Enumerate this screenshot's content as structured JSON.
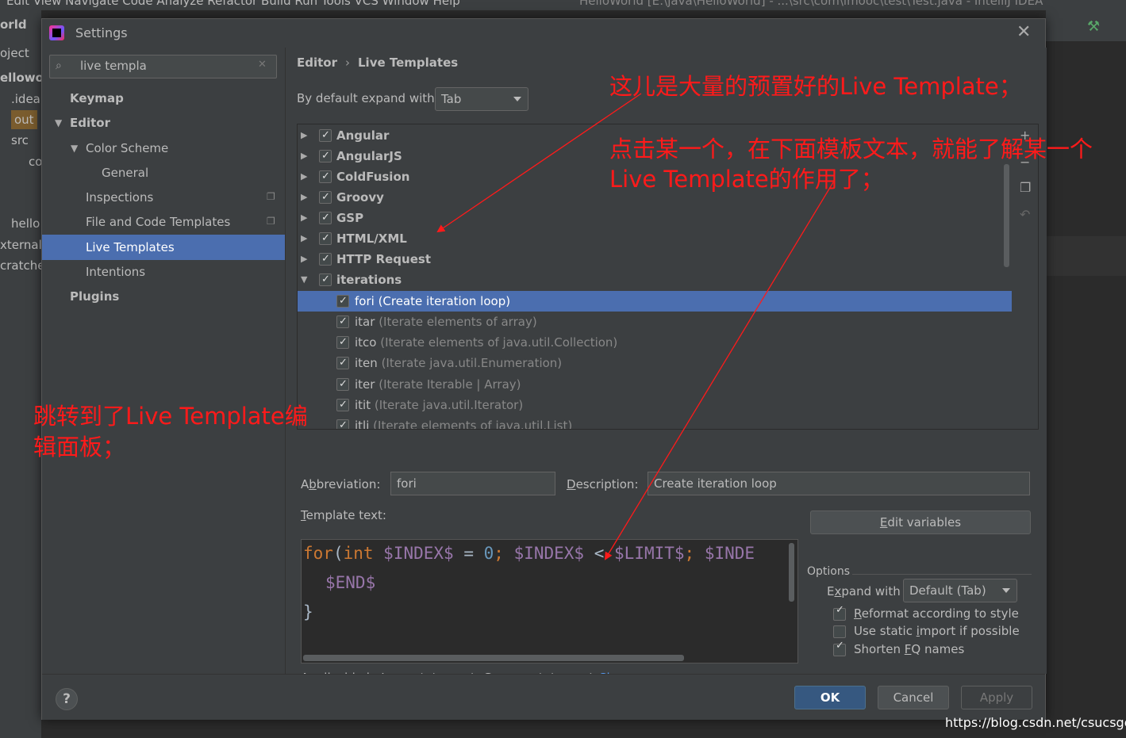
{
  "ide": {
    "menu_fragment": "Edit  View  Navigate  Code  Analyze  Refactor  Build  Run  Tools  VCS  Window  Help",
    "window_title_fragment": "HelloWorld [E:\\java\\HelloWorld] - ...\\src\\com\\imooc\\test\\Test.java - IntelliJ IDEA",
    "project_items": [
      "orld",
      "oject",
      "ellowo",
      ".idea",
      "out",
      "src",
      "co",
      "hello",
      "xternal",
      "cratche"
    ]
  },
  "dialog": {
    "title": "Settings",
    "close_glyph": "✕"
  },
  "sidebar": {
    "search_value": "live templa",
    "search_icon": "⌕",
    "clear_glyph": "✕",
    "items": [
      {
        "label": "Keymap"
      },
      {
        "label": "Editor"
      },
      {
        "label": "Color Scheme"
      },
      {
        "label": "General"
      },
      {
        "label": "Inspections"
      },
      {
        "label": "File and Code Templates"
      },
      {
        "label": "Live Templates"
      },
      {
        "label": "Intentions"
      },
      {
        "label": "Plugins"
      }
    ]
  },
  "main": {
    "breadcrumb": {
      "parent": "Editor",
      "separator": "›",
      "current": "Live Templates"
    },
    "expand_label": "By default expand with",
    "expand_value": "Tab",
    "groups": [
      {
        "name": "Angular",
        "checked": true
      },
      {
        "name": "AngularJS",
        "checked": true
      },
      {
        "name": "ColdFusion",
        "checked": true
      },
      {
        "name": "Groovy",
        "checked": true
      },
      {
        "name": "GSP",
        "checked": true
      },
      {
        "name": "HTML/XML",
        "checked": true
      },
      {
        "name": "HTTP Request",
        "checked": true
      },
      {
        "name": "iterations",
        "checked": true
      }
    ],
    "templates": [
      {
        "abbr": "fori",
        "desc": "(Create iteration loop)",
        "checked": true
      },
      {
        "abbr": "itar",
        "desc": "(Iterate elements of array)",
        "checked": true
      },
      {
        "abbr": "itco",
        "desc": "(Iterate elements of java.util.Collection)",
        "checked": true
      },
      {
        "abbr": "iten",
        "desc": "(Iterate java.util.Enumeration)",
        "checked": true
      },
      {
        "abbr": "iter",
        "desc": "(Iterate Iterable | Array)",
        "checked": true
      },
      {
        "abbr": "itit",
        "desc": "(Iterate java.util.Iterator)",
        "checked": true
      },
      {
        "abbr": "itli",
        "desc": "(Iterate elements of java.util.List)",
        "checked": true
      }
    ],
    "toolbar": {
      "add": "+",
      "remove": "−",
      "copy": "❐",
      "restore": "↶"
    },
    "abbreviation_label_pre": "A",
    "abbreviation_label_u": "b",
    "abbreviation_label_post": "breviation:",
    "abbreviation_value": "fori",
    "description_label_u": "D",
    "description_label_post": "escription:",
    "description_value": "Create iteration loop",
    "template_text_label_u": "T",
    "template_text_label_post": "emplate text:",
    "code": {
      "l1_kw": "for",
      "l1_p1": "(",
      "l1_kw2": "int",
      "l1_var1": " $INDEX$",
      "l1_p2": " = ",
      "l1_num": "0",
      "l1_p3": "; ",
      "l1_var2": "$INDEX$",
      "l1_p4": " < ",
      "l1_var3": "$LIMIT$",
      "l1_p5": "; ",
      "l1_var4": "$INDE",
      "l2_var": "$END$",
      "l3": "}"
    },
    "edit_variables_u": "E",
    "edit_variables_post": "dit variables",
    "options_label": "Options",
    "expand_with_label_pre": "E",
    "expand_with_label_u": "x",
    "expand_with_label_post": "pand with",
    "expand_with_value": "Default (Tab)",
    "options": [
      {
        "u": "R",
        "post": "eformat according to style",
        "pre": "",
        "checked": true
      },
      {
        "pre": "Use static ",
        "u": "i",
        "post": "mport if possible",
        "checked": false
      },
      {
        "pre": "Shorten ",
        "u": "F",
        "post": "Q names",
        "checked": true
      }
    ],
    "applicable_text": "Applicable in Java: statement; Groovy: statement.",
    "change_link": "Change",
    "change_caret": "⌄"
  },
  "footer": {
    "help": "?",
    "ok": "OK",
    "cancel": "Cancel",
    "apply": "Apply"
  },
  "annotations": {
    "top": "这儿是大量的预置好的Live Template；",
    "mid_line1": "点击某一个，在下面模板文本，就能了解某一个",
    "mid_line2": "Live Template的作用了；",
    "left_line1": "跳转到了Live Template编",
    "left_line2": "辑面板；",
    "color": "#ff1a1a"
  },
  "watermark": "https://blog.csdn.net/csucsgoat"
}
